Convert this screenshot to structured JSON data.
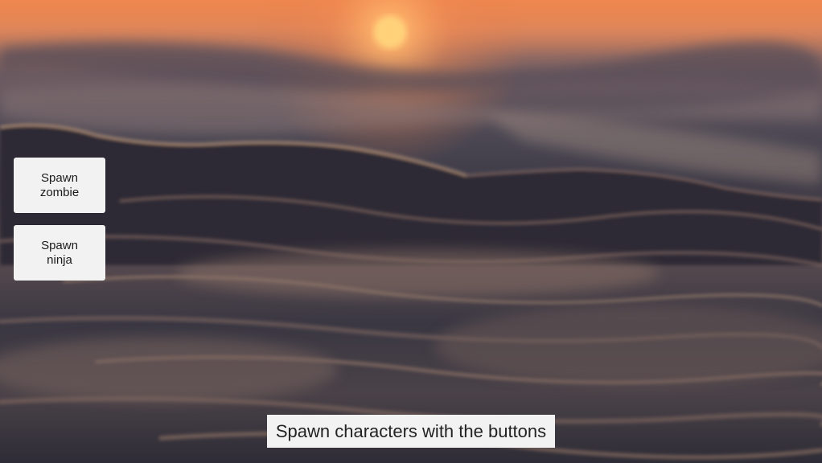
{
  "buttons": {
    "spawn_zombie": {
      "line1": "Spawn",
      "line2": "zombie"
    },
    "spawn_ninja": {
      "line1": "Spawn",
      "line2": "ninja"
    }
  },
  "instruction": "Spawn characters with the buttons",
  "colors": {
    "sky_orange": "#e8834f",
    "sun": "#ffd27a",
    "water_dark": "#2b2a35",
    "water_highlight": "#c49a78",
    "button_bg": "#f2f2f2"
  }
}
